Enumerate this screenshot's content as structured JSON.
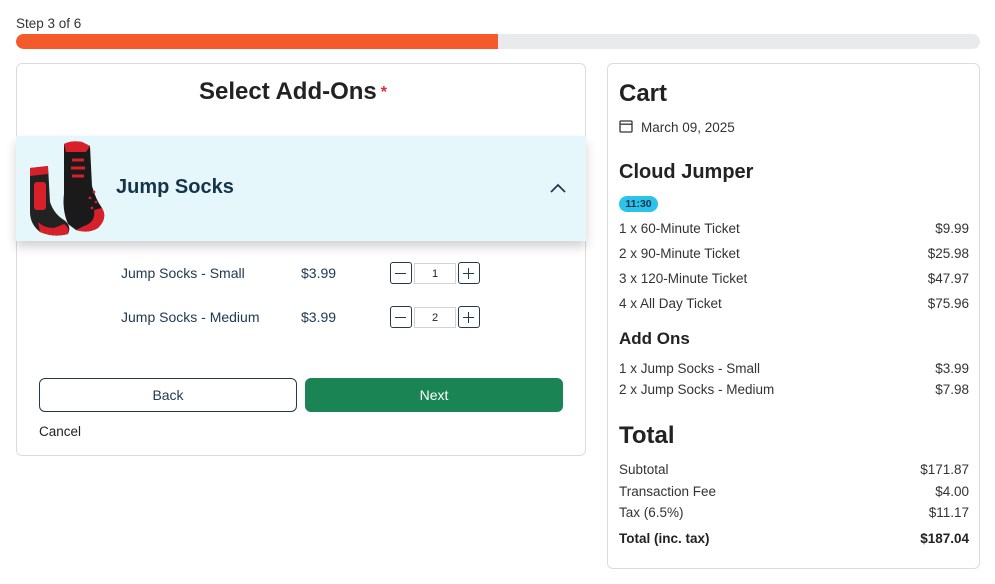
{
  "progress": {
    "label": "Step 3 of 6",
    "current_step": 3,
    "total_steps": 6,
    "fraction": 0.5,
    "color": "#f55a2b"
  },
  "addons": {
    "title": "Select Add-Ons",
    "required_marker": "*",
    "product": {
      "name": "Jump Socks",
      "image_icon": "jump-socks-image",
      "expanded": true,
      "variants": [
        {
          "name": "Jump Socks - Small",
          "price": "$3.99",
          "quantity": "1"
        },
        {
          "name": "Jump Socks - Medium",
          "price": "$3.99",
          "quantity": "2"
        }
      ]
    },
    "back_label": "Back",
    "next_label": "Next",
    "cancel_label": "Cancel"
  },
  "cart": {
    "title": "Cart",
    "date": "March 09, 2025",
    "attraction": "Cloud Jumper",
    "time": "11:30",
    "tickets": [
      {
        "label": "1 x 60-Minute Ticket",
        "amount": "$9.99"
      },
      {
        "label": "2 x 90-Minute Ticket",
        "amount": "$25.98"
      },
      {
        "label": "3 x 120-Minute Ticket",
        "amount": "$47.97"
      },
      {
        "label": "4 x All Day Ticket",
        "amount": "$75.96"
      }
    ],
    "addons_heading": "Add Ons",
    "addons": [
      {
        "label": "1 x Jump Socks - Small",
        "amount": "$3.99"
      },
      {
        "label": "2 x Jump Socks - Medium",
        "amount": "$7.98"
      }
    ],
    "total_heading": "Total",
    "totals": [
      {
        "label": "Subtotal",
        "amount": "$171.87"
      },
      {
        "label": "Transaction Fee",
        "amount": "$4.00"
      },
      {
        "label": "Tax (6.5%)",
        "amount": "$11.17"
      }
    ],
    "grand_total": {
      "label": "Total (inc. tax)",
      "amount": "$187.04"
    }
  },
  "colors": {
    "accent": "#f55a2b",
    "primary_button": "#1b8454",
    "badge": "#2bc3ea",
    "panel_bg": "#e6f7fc",
    "required": "#e0283a"
  }
}
